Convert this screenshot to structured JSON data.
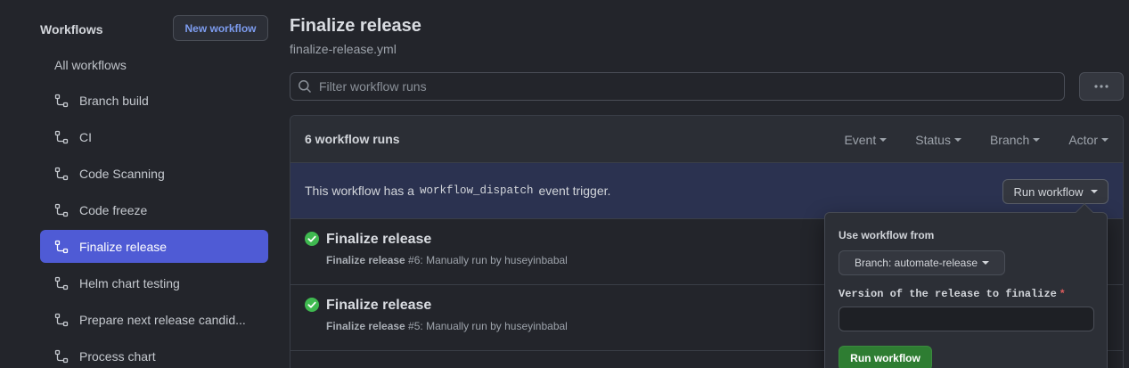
{
  "sidebar": {
    "title": "Workflows",
    "new_button": "New workflow",
    "all_workflows": "All workflows",
    "items": [
      {
        "label": "Branch build",
        "active": false
      },
      {
        "label": "CI",
        "active": false
      },
      {
        "label": "Code Scanning",
        "active": false
      },
      {
        "label": "Code freeze",
        "active": false
      },
      {
        "label": "Finalize release",
        "active": true
      },
      {
        "label": "Helm chart testing",
        "active": false
      },
      {
        "label": "Prepare next release candid...",
        "active": false
      },
      {
        "label": "Process chart",
        "active": false
      }
    ]
  },
  "main": {
    "title": "Finalize release",
    "file": "finalize-release.yml",
    "filter_placeholder": "Filter workflow runs",
    "runs_count": "6 workflow runs",
    "filters": [
      "Event",
      "Status",
      "Branch",
      "Actor"
    ],
    "dispatch": {
      "prefix": "This workflow has a",
      "code": "workflow_dispatch",
      "suffix": "event trigger.",
      "button": "Run workflow"
    },
    "runs": [
      {
        "title": "Finalize release",
        "meta_name": "Finalize release",
        "meta_rest": " #6: Manually run by huseyinbabal",
        "status": "success"
      },
      {
        "title": "Finalize release",
        "meta_name": "Finalize release",
        "meta_rest": " #5: Manually run by huseyinbabal",
        "status": "success"
      }
    ]
  },
  "dropdown": {
    "use_from_label": "Use workflow from",
    "branch_button": "Branch: automate-release",
    "input_label": "Version of the release to finalize",
    "required_mark": "*",
    "version_value": "",
    "submit": "Run workflow"
  },
  "colors": {
    "accent": "#4f5bd5",
    "success": "#3fb950",
    "primary_button": "#2e7d32"
  }
}
